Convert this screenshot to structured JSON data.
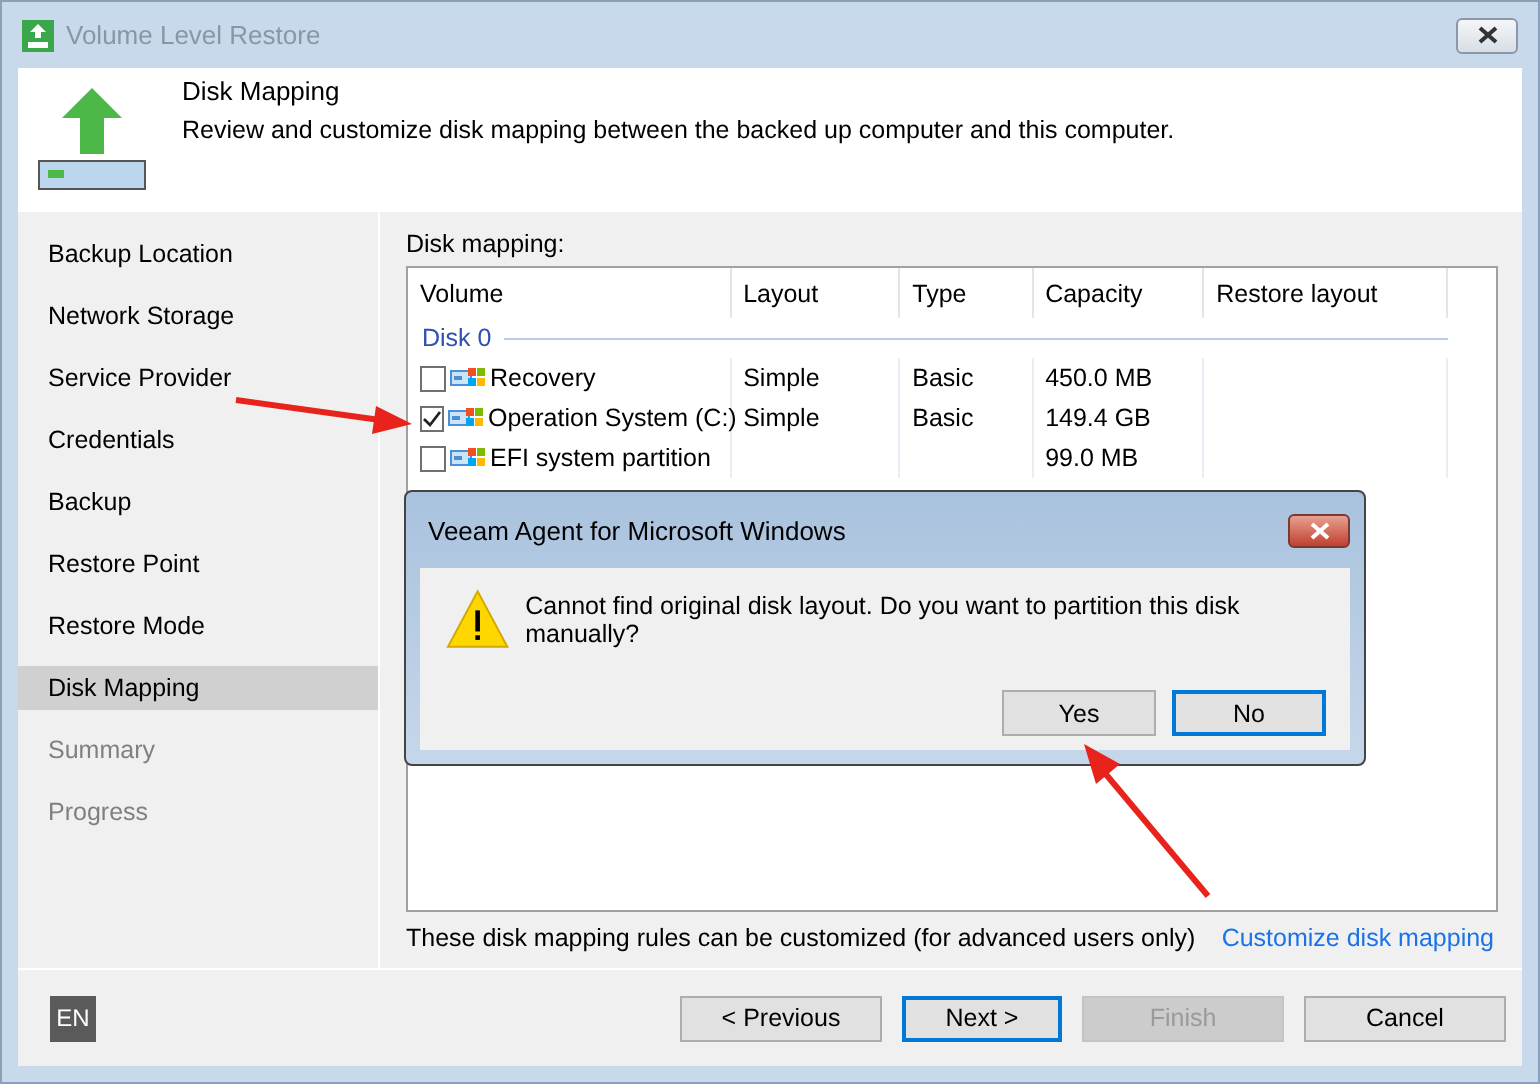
{
  "window": {
    "title": "Volume Level Restore"
  },
  "header": {
    "title": "Disk Mapping",
    "subtitle": "Review and customize disk mapping between the backed up computer and this computer."
  },
  "sidebar": {
    "items": [
      {
        "label": "Backup Location",
        "selected": false,
        "disabled": false
      },
      {
        "label": "Network Storage",
        "selected": false,
        "disabled": false
      },
      {
        "label": "Service Provider",
        "selected": false,
        "disabled": false
      },
      {
        "label": "Credentials",
        "selected": false,
        "disabled": false
      },
      {
        "label": "Backup",
        "selected": false,
        "disabled": false
      },
      {
        "label": "Restore Point",
        "selected": false,
        "disabled": false
      },
      {
        "label": "Restore Mode",
        "selected": false,
        "disabled": false
      },
      {
        "label": "Disk Mapping",
        "selected": true,
        "disabled": false
      },
      {
        "label": "Summary",
        "selected": false,
        "disabled": true
      },
      {
        "label": "Progress",
        "selected": false,
        "disabled": true
      }
    ]
  },
  "table": {
    "label": "Disk mapping:",
    "columns": [
      "Volume",
      "Layout",
      "Type",
      "Capacity",
      "Restore layout"
    ],
    "groups": [
      {
        "name": "Disk 0",
        "rows": [
          {
            "checked": false,
            "volume": "Recovery",
            "layout": "Simple",
            "type": "Basic",
            "capacity": "450.0 MB"
          },
          {
            "checked": true,
            "volume": "Operation System (C:)",
            "layout": "Simple",
            "type": "Basic",
            "capacity": "149.4 GB"
          },
          {
            "checked": false,
            "volume": "EFI system partition",
            "layout": "",
            "type": "",
            "capacity": "99.0 MB"
          }
        ]
      }
    ]
  },
  "note": "These disk mapping rules can be customized (for advanced users only)",
  "link": "Customize disk mapping",
  "language": "EN",
  "buttons": [
    {
      "label": "< Previous",
      "focused": false,
      "disabled": false
    },
    {
      "label": "Next >",
      "focused": true,
      "disabled": false
    },
    {
      "label": "Finish",
      "focused": false,
      "disabled": true
    },
    {
      "label": "Cancel",
      "focused": false,
      "disabled": false
    }
  ],
  "dialog": {
    "title": "Veeam Agent for Microsoft Windows",
    "message": "Cannot find original disk layout. Do you want to partition this disk manually?",
    "buttons": [
      {
        "label": "Yes",
        "focused": false
      },
      {
        "label": "No",
        "focused": true
      }
    ]
  }
}
